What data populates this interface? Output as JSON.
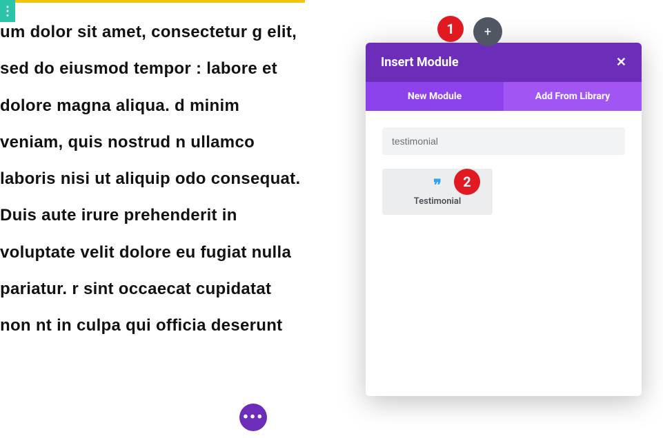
{
  "lorem_text": "um dolor sit amet, consectetur g elit, sed do eiusmod tempor : labore et dolore magna aliqua. d minim veniam, quis nostrud n ullamco laboris nisi ut aliquip odo consequat. Duis aute irure prehenderit in voluptate velit dolore eu fugiat nulla pariatur. r sint occaecat cupidatat non nt in culpa qui officia deserunt",
  "modal": {
    "title": "Insert Module",
    "close_glyph": "✕",
    "tabs": {
      "new": "New Module",
      "library": "Add From Library"
    },
    "search_value": "testimonial",
    "module": {
      "icon_glyph": "❞",
      "label": "Testimonial"
    }
  },
  "add_button_glyph": "+",
  "fab_glyph": "•••",
  "callouts": {
    "one": "1",
    "two": "2"
  }
}
